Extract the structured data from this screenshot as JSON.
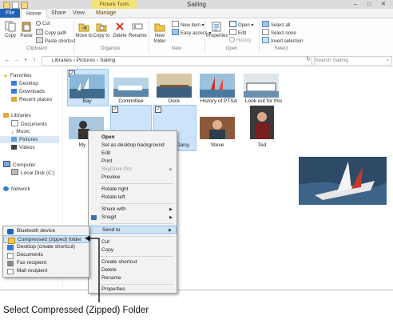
{
  "window": {
    "title": "Sailing",
    "contextual_tab": "Picture Tools",
    "min_label": "–",
    "max_label": "□",
    "close_label": "✕"
  },
  "tabs": [
    "File",
    "Home",
    "Share",
    "View",
    "Manage"
  ],
  "ribbon": {
    "clipboard": {
      "copy": "Copy",
      "paste": "Paste",
      "cut": "Cut",
      "copy_path": "Copy path",
      "paste_shortcut": "Paste shortcut",
      "group_label": "Clipboard"
    },
    "organize": {
      "move_to": "Move to",
      "copy_to": "Copy to",
      "delete": "Delete",
      "rename": "Rename",
      "group_label": "Organize"
    },
    "new": {
      "new_folder": "New folder",
      "new_item": "New item",
      "easy_access": "Easy access",
      "group_label": "New"
    },
    "open": {
      "properties": "Properties",
      "open": "Open",
      "edit": "Edit",
      "history": "History",
      "group_label": "Open"
    },
    "select": {
      "select_all": "Select all",
      "select_none": "Select none",
      "invert_selection": "Invert selection",
      "group_label": "Select"
    }
  },
  "address": {
    "breadcrumb": "Libraries  ›  Pictures  ›  Sailing",
    "search_placeholder": "Search Sailing"
  },
  "nav": {
    "favorites": "Favorites",
    "desktop": "Desktop",
    "downloads": "Downloads",
    "recent_places": "Recent places",
    "libraries": "Libraries",
    "documents": "Documents",
    "music": "Music",
    "pictures": "Pictures",
    "videos": "Videos",
    "computer": "Computer",
    "local_disk": "Local Disk (C:)",
    "network": "Network"
  },
  "files": {
    "bay": "Bay",
    "committee": "Committee",
    "dock": "Dock",
    "history": "History of PTSA",
    "lookout": "Look out for this",
    "my": "My",
    "daisy": "Daisy",
    "steve": "Steve",
    "ted": "Ted"
  },
  "context_menu": {
    "open": "Open",
    "set_background": "Set as desktop background",
    "edit": "Edit",
    "print": "Print",
    "skydrive": "SkyDrive Pro",
    "preview": "Preview",
    "rotate_right": "Rotate right",
    "rotate_left": "Rotate left",
    "share_with": "Share with",
    "snagit": "Snagit",
    "send_to": "Send to",
    "cut": "Cut",
    "copy": "Copy",
    "create_shortcut": "Create shortcut",
    "delete": "Delete",
    "rename": "Rename",
    "properties": "Properties"
  },
  "send_to_menu": {
    "bluetooth": "Bluetooth device",
    "compressed": "Compressed (zipped) folder",
    "desktop": "Desktop (create shortcut)",
    "documents": "Documents",
    "fax": "Fax recipient",
    "mail": "Mail recipient"
  },
  "callout": "Select Compressed (Zipped) Folder",
  "colors": {
    "accent": "#1d63b7",
    "selection": "#cce3f9",
    "tools_tab": "#f4e27c"
  }
}
